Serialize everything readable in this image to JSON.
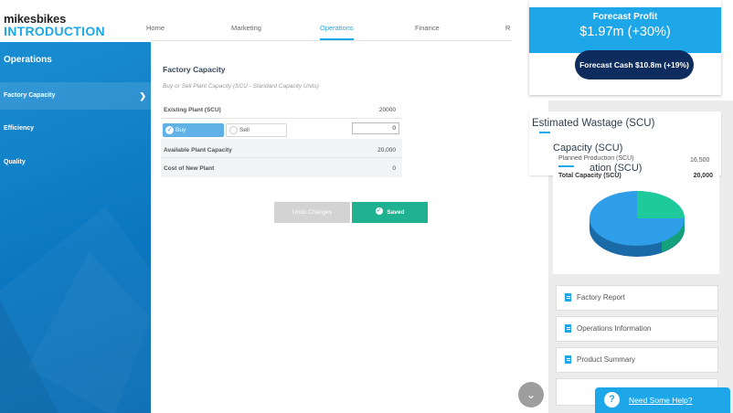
{
  "app": {
    "logo_top": "mikesbikes",
    "logo_bottom": "INTRODUCTION"
  },
  "topnav": {
    "tabs": [
      "Home",
      "Marketing",
      "Operations",
      "Finance",
      "R"
    ],
    "active": "Operations"
  },
  "sidebar": {
    "title": "Operations",
    "items": [
      {
        "label": "Factory Capacity",
        "active": true
      },
      {
        "label": "Efficiency"
      },
      {
        "label": "Quality"
      }
    ]
  },
  "main": {
    "title": "Factory Capacity",
    "subtitle": "Buy or Sell Plant Capacity (SCU - Standard Capacity Units)",
    "existing_label": "Existing Plant (SCU)",
    "existing_value": "20000",
    "buy_label": "Buy",
    "sell_label": "Sell",
    "input_value": "0",
    "available_label": "Available Plant Capacity",
    "available_value": "20,000",
    "cost_label": "Cost of New Plant",
    "cost_value": "0",
    "undo_label": "Undo Changes",
    "saved_label": "Saved"
  },
  "forecast": {
    "profit_label": "Forecast Profit",
    "profit_value": "$1.97m (+30%)",
    "cash_label": "Forecast Cash $10.8m (+19%)"
  },
  "wastage": {
    "title": "Estimated Wastage (SCU)"
  },
  "capacity": {
    "title": "Capacity (SCU)",
    "planned_label": "Planned Production (SCU)",
    "planned_value": "16,500",
    "ghost_text": "ation (SCU)",
    "total_label": "Total Capacity (SCU)",
    "total_value": "20,000",
    "pie_colors": {
      "main": "#2e9ee8",
      "slice": "#1ec99b"
    }
  },
  "links": [
    {
      "label": "Factory Report"
    },
    {
      "label": "Operations Information"
    },
    {
      "label": "Product Summary"
    }
  ],
  "help": {
    "label": "Need Some Help?"
  },
  "icons": {
    "scroll": "chevron-down-icon",
    "help": "question-icon",
    "doc": "document-icon"
  }
}
